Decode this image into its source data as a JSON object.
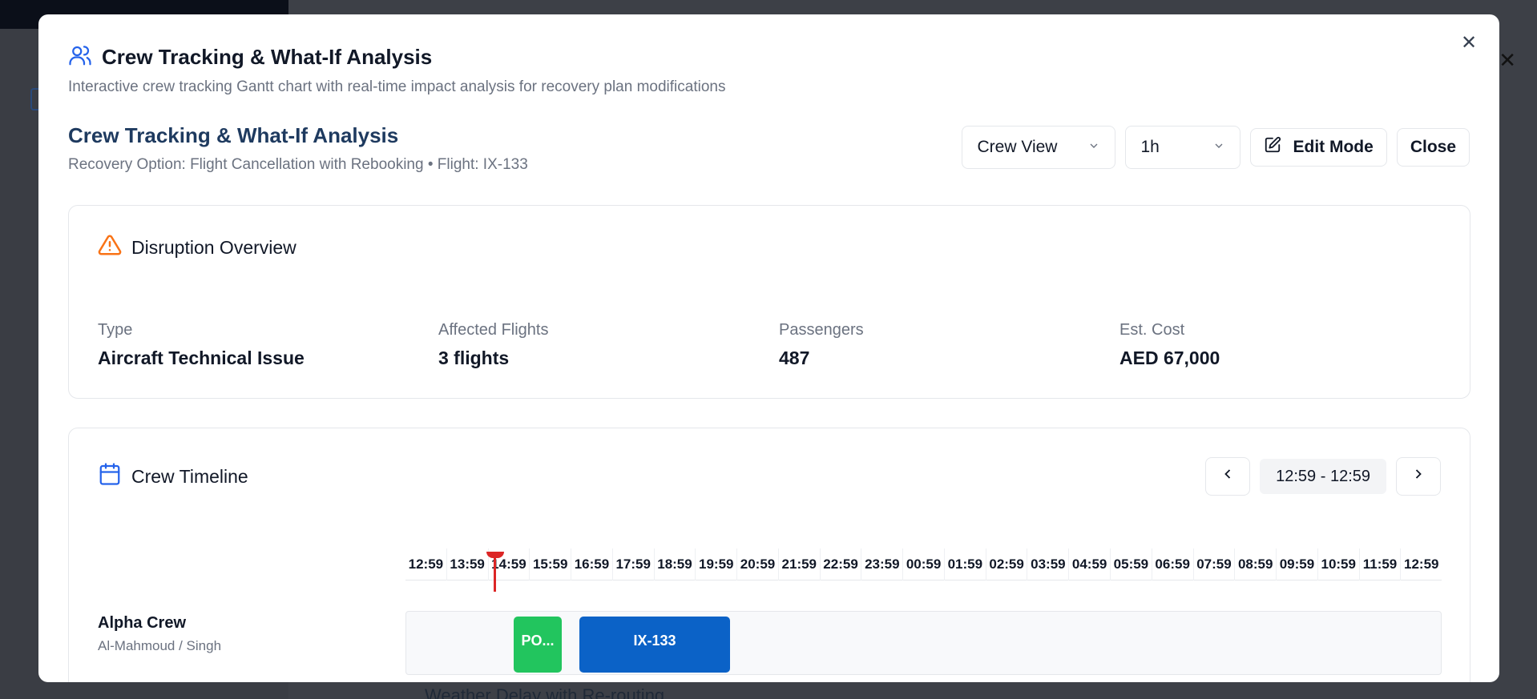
{
  "dialog": {
    "title": "Crew Tracking & What-If Analysis",
    "description": "Interactive crew tracking Gantt chart with real-time impact analysis for recovery plan modifications",
    "close_icon": "close-icon"
  },
  "section": {
    "title": "Crew Tracking & What-If Analysis",
    "subtitle": "Recovery Option: Flight Cancellation with Rebooking • Flight: IX-133"
  },
  "controls": {
    "view_select": "Crew View",
    "zoom_select": "1h",
    "edit_label": "Edit Mode",
    "close_label": "Close"
  },
  "overview": {
    "title": "Disruption Overview",
    "stats": [
      {
        "label": "Type",
        "value": "Aircraft Technical Issue"
      },
      {
        "label": "Affected Flights",
        "value": "3 flights"
      },
      {
        "label": "Passengers",
        "value": "487"
      },
      {
        "label": "Est. Cost",
        "value": "AED 67,000"
      }
    ]
  },
  "timeline": {
    "title": "Crew Timeline",
    "range": "12:59 - 12:59",
    "ticks": [
      "12:59",
      "13:59",
      "14:59",
      "15:59",
      "16:59",
      "17:59",
      "18:59",
      "19:59",
      "20:59",
      "21:59",
      "22:59",
      "23:59",
      "00:59",
      "01:59",
      "02:59",
      "03:59",
      "04:59",
      "05:59",
      "06:59",
      "07:59",
      "08:59",
      "09:59",
      "10:59",
      "11:59",
      "12:59"
    ],
    "crews": [
      {
        "name": "Alpha Crew",
        "members": "Al-Mahmoud / Singh",
        "segments": [
          {
            "label": "PO...",
            "color": "#22c55e"
          },
          {
            "label": "IX-133",
            "color": "#0b62c7"
          }
        ]
      }
    ]
  },
  "background": {
    "bottom_text": "Weather Delay with Re-routing"
  }
}
